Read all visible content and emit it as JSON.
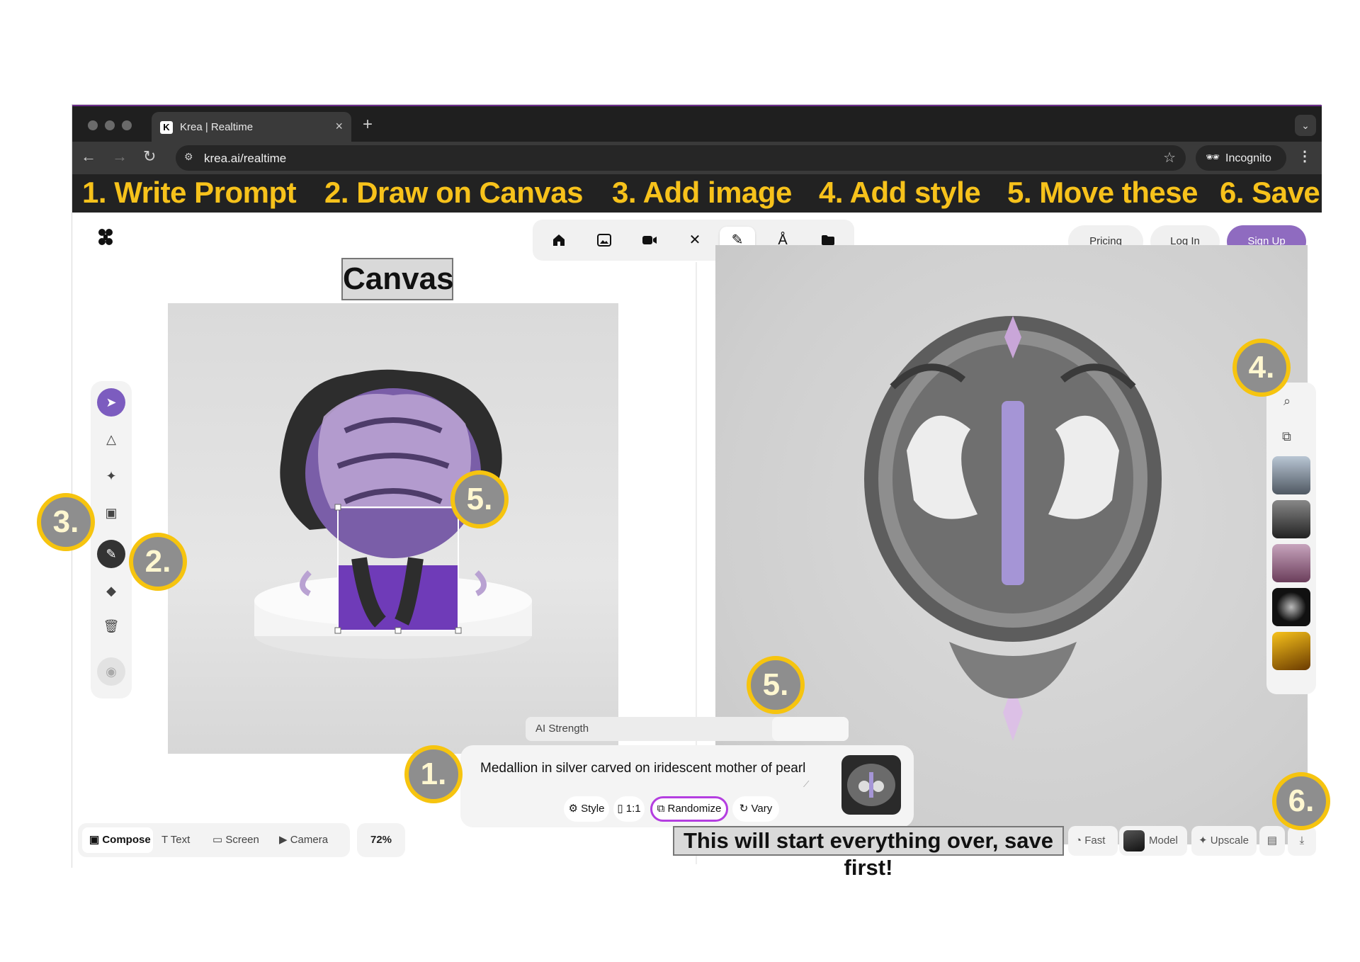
{
  "browser": {
    "tab_title": "Krea | Realtime",
    "tab_favicon": "K",
    "url": "krea.ai/realtime",
    "incognito_label": "Incognito"
  },
  "steps": {
    "s1": "1. Write Prompt",
    "s2": "2. Draw on Canvas",
    "s3": "3. Add image",
    "s4": "4. Add style",
    "s5": "5. Move these",
    "s6": "6. Save"
  },
  "header": {
    "pricing": "Pricing",
    "login": "Log In",
    "signup": "Sign Up",
    "nav_icons": [
      "home-icon",
      "image-icon",
      "video-icon",
      "enhance-icon",
      "realtime-pen-icon",
      "train-icon",
      "folder-icon"
    ]
  },
  "canvas": {
    "label": "Canvas"
  },
  "tools": [
    "select-icon",
    "shapes-icon",
    "sparkle-icon",
    "image-upload-icon",
    "brush-icon",
    "eraser-icon",
    "trash-icon",
    "background-icon"
  ],
  "prompt": {
    "ai_strength_label": "AI Strength",
    "text": "Medallion in silver carved on iridescent mother of pearl",
    "style": "Style",
    "ratio": "1:1",
    "randomize": "Randomize",
    "vary": "Vary"
  },
  "bottom": {
    "compose": "Compose",
    "text": "Text",
    "screen": "Screen",
    "camera": "Camera",
    "zoom": "72%",
    "warning": "This will start everything over, save first!",
    "fast": "Fast",
    "model": "Model",
    "upscale": "Upscale"
  },
  "badges": {
    "b1": "1.",
    "b2": "2.",
    "b3": "3.",
    "b4": "4.",
    "b5a": "5.",
    "b5b": "5.",
    "b6": "6."
  },
  "colors": {
    "accent_purple": "#8f6bc0",
    "step_yellow": "#f7c21b",
    "badge_ring": "#f6c40f"
  }
}
